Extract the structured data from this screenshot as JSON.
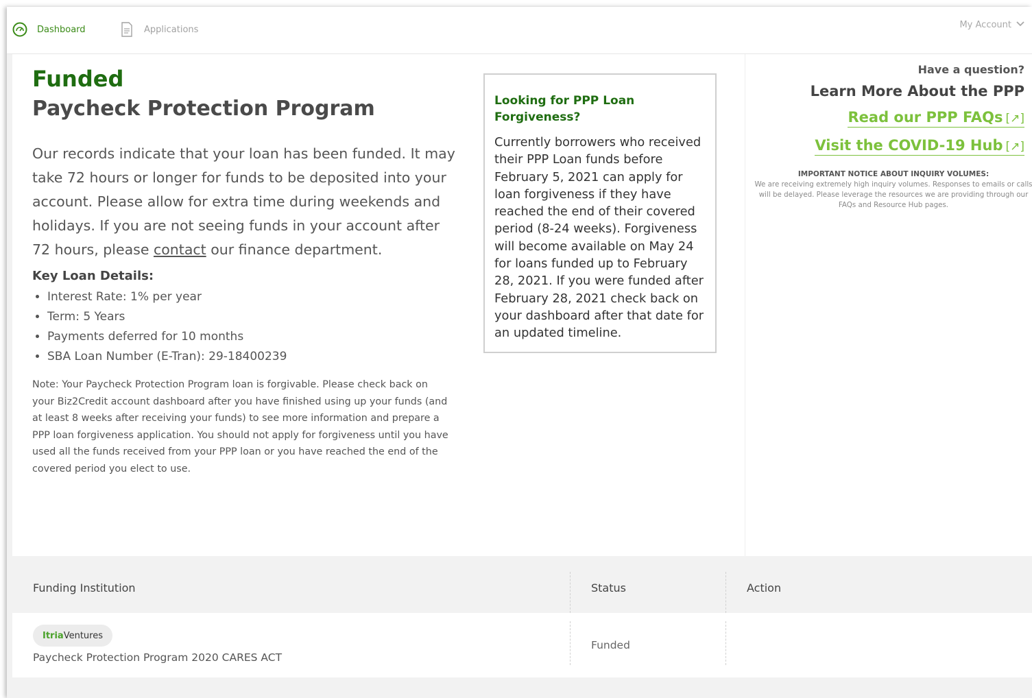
{
  "nav": {
    "dashboard_label": "Dashboard",
    "applications_label": "Applications",
    "account_label": "My Account"
  },
  "main": {
    "status_title": "Funded",
    "program_title": "Paycheck Protection Program",
    "lead_before": "Our records indicate that your loan has been funded. It may take 72 hours or longer for funds to be deposited into your account. Please allow for extra time during weekends and holidays. If you are not seeing funds in your account after 72 hours, please ",
    "lead_link": "contact",
    "lead_after": " our finance department.",
    "key_details_title": "Key Loan Details:",
    "key_details": [
      "Interest Rate: 1% per year",
      "Term: 5 Years",
      "Payments deferred for 10 months",
      "SBA Loan Number (E-Tran): 29-18400239"
    ],
    "note": "Note: Your Paycheck Protection Program loan is forgivable. Please check back on your Biz2Credit account dashboard after you have finished using up your funds (and at least 8 weeks after receiving your funds) to see more information and prepare a PPP loan forgiveness application. You should not apply for forgiveness until you have used all the funds received from your PPP loan or you have reached the end of the covered period you elect to use."
  },
  "forgiveness_box": {
    "title": "Looking for PPP Loan Forgiveness?",
    "body": "Currently borrowers who received their PPP Loan funds before February 5, 2021 can apply for loan forgiveness if they have reached the end of their covered period (8-24 weeks). Forgiveness will become available on May 24 for loans funded up to February 28, 2021. If you were funded after February 28, 2021 check back on your dashboard after that date for an updated timeline."
  },
  "sidebar": {
    "question": "Have a question?",
    "learn_more": "Learn More About the PPP",
    "faq_link": "Read our PPP FAQs",
    "hub_link": "Visit the COVID-19 Hub",
    "external_marker": "[↗]",
    "notice_title": "IMPORTANT NOTICE ABOUT INQUIRY VOLUMES:",
    "notice_body": "We are receiving extremely high inquiry volumes. Responses to emails or calls will be delayed. Please leverage the resources we are providing through our FAQs and Resource Hub pages."
  },
  "table": {
    "headers": {
      "institution": "Funding Institution",
      "status": "Status",
      "action": "Action"
    },
    "rows": [
      {
        "logo_bold": "Itria",
        "logo_rest": "Ventures",
        "program": "Paycheck Protection Program 2020 CARES ACT",
        "status": "Funded"
      }
    ]
  },
  "colors": {
    "brand_green": "#1f6d11",
    "link_green": "#7cc13c",
    "nav_active": "#3a8b17"
  }
}
